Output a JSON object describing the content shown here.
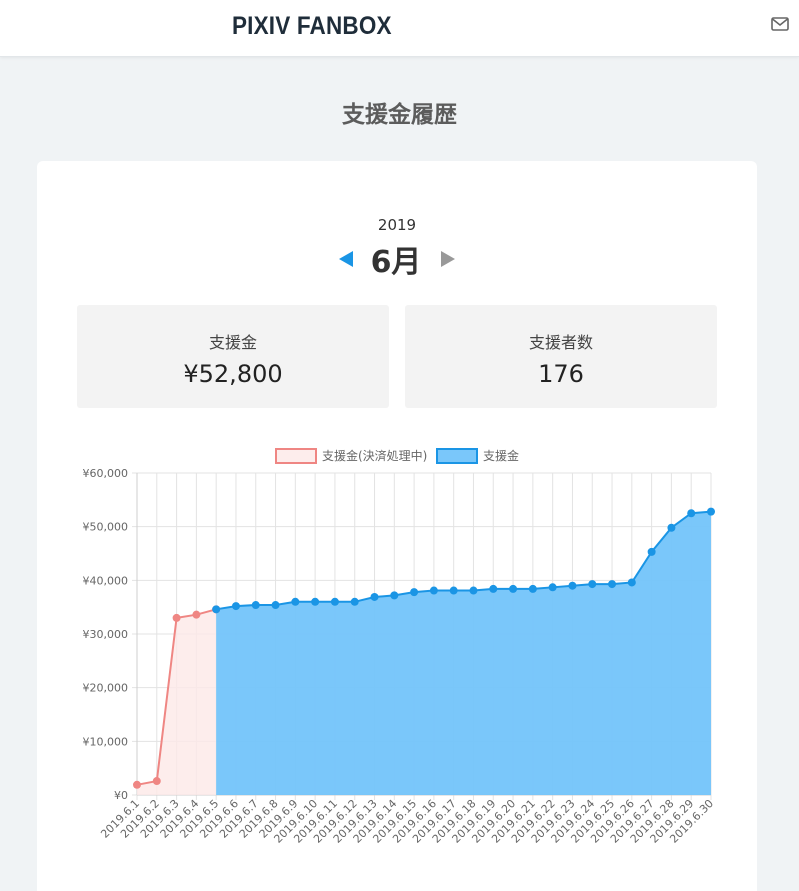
{
  "header": {
    "logo": "PIXIV FANBOX",
    "mail_icon": "mail-icon"
  },
  "page": {
    "title": "支援金履歴"
  },
  "period": {
    "year": "2019",
    "month": "6月"
  },
  "stats": {
    "amount": {
      "label": "支援金",
      "value": "¥52,800"
    },
    "supporters": {
      "label": "支援者数",
      "value": "176"
    }
  },
  "colors": {
    "accent": "#1a95e5",
    "pending_line": "#ef8683",
    "pending_fill": "#fde8e7",
    "confirmed_line": "#1a95e5",
    "confirmed_fill": "#73c4fa"
  },
  "chart_data": {
    "type": "area",
    "legend": [
      "支援金(決済処理中)",
      "支援金"
    ],
    "legend_position": "top",
    "grid": true,
    "ylim": [
      0,
      60000
    ],
    "yticks": [
      "¥0",
      "¥10,000",
      "¥20,000",
      "¥30,000",
      "¥40,000",
      "¥50,000",
      "¥60,000"
    ],
    "categories": [
      "2019.6.1",
      "2019.6.2",
      "2019.6.3",
      "2019.6.4",
      "2019.6.5",
      "2019.6.6",
      "2019.6.7",
      "2019.6.8",
      "2019.6.9",
      "2019.6.10",
      "2019.6.11",
      "2019.6.12",
      "2019.6.13",
      "2019.6.14",
      "2019.6.15",
      "2019.6.16",
      "2019.6.17",
      "2019.6.18",
      "2019.6.19",
      "2019.6.20",
      "2019.6.21",
      "2019.6.22",
      "2019.6.23",
      "2019.6.24",
      "2019.6.25",
      "2019.6.26",
      "2019.6.27",
      "2019.6.28",
      "2019.6.29",
      "2019.6.30"
    ],
    "series": [
      {
        "name": "支援金(決済処理中)",
        "values": [
          1900,
          2600,
          33000,
          33600,
          34600,
          null,
          null,
          null,
          null,
          null,
          null,
          null,
          null,
          null,
          null,
          null,
          null,
          null,
          null,
          null,
          null,
          null,
          null,
          null,
          null,
          null,
          null,
          null,
          null,
          null
        ]
      },
      {
        "name": "支援金",
        "values": [
          null,
          null,
          null,
          null,
          34600,
          35200,
          35400,
          35400,
          36000,
          36000,
          36000,
          36000,
          36900,
          37200,
          37800,
          38100,
          38100,
          38100,
          38400,
          38400,
          38400,
          38700,
          39000,
          39300,
          39300,
          39600,
          45300,
          49800,
          52500,
          52800
        ]
      }
    ]
  }
}
